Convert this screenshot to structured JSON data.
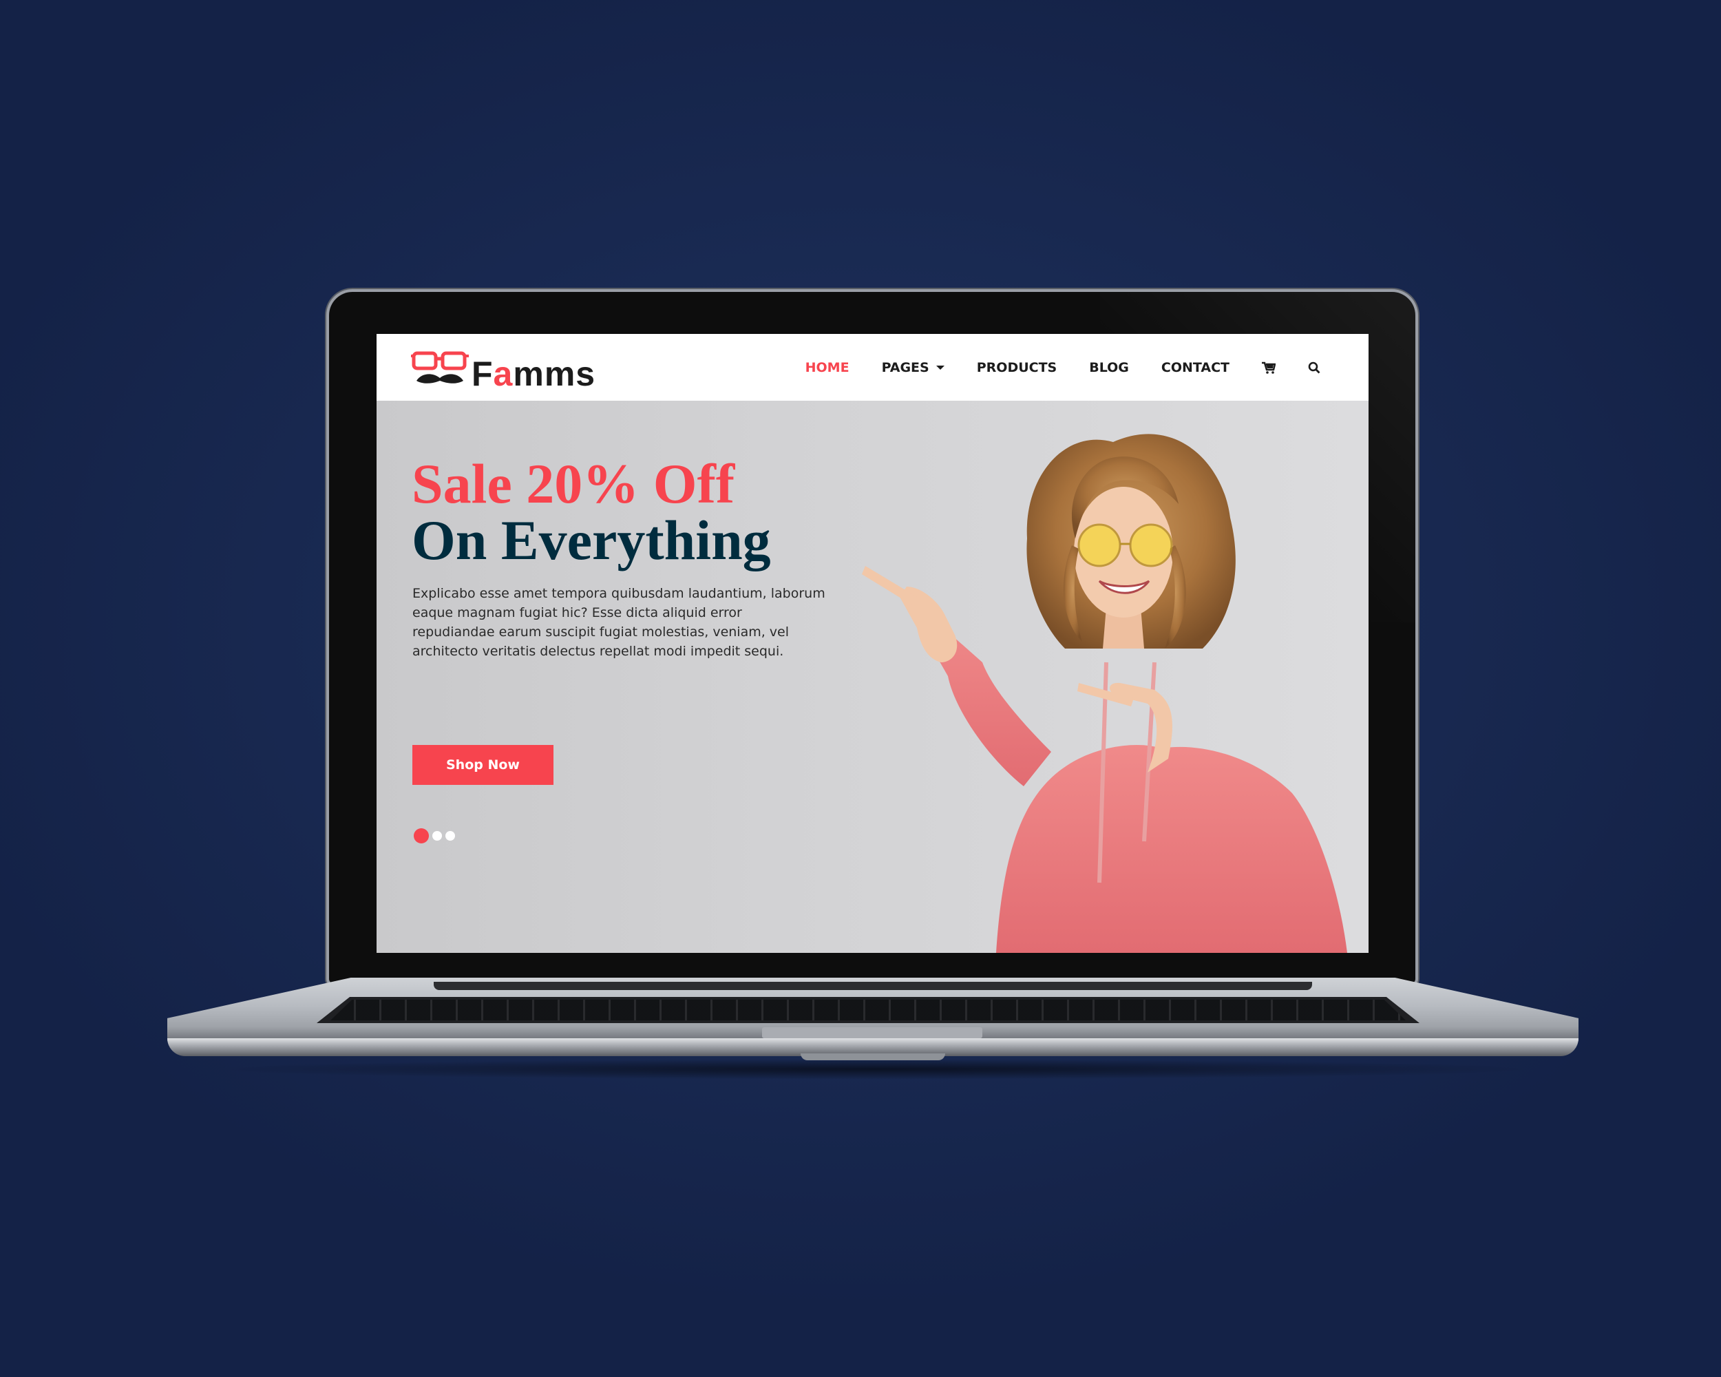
{
  "brand": {
    "name_part1": "F",
    "name_accent": "a",
    "name_part2": "mms",
    "accent_color": "#f7444e",
    "dark_color": "#002c3e"
  },
  "nav": {
    "items": [
      {
        "label": "HOME",
        "active": true
      },
      {
        "label": "PAGES",
        "dropdown": true
      },
      {
        "label": "PRODUCTS"
      },
      {
        "label": "BLOG"
      },
      {
        "label": "CONTACT"
      }
    ],
    "icons": [
      "cart-icon",
      "search-icon"
    ]
  },
  "hero": {
    "title_line1": "Sale 20% Off",
    "title_line2": "On Everything",
    "description": "Explicabo esse amet tempora quibusdam laudantium, laborum eaque magnam fugiat hic? Esse dicta aliquid error repudiandae earum suscipit fugiat molestias, veniam, vel architecto veritatis delectus repellat modi impedit sequi.",
    "button_label": "Shop Now",
    "slides": 3,
    "active_slide": 1
  }
}
